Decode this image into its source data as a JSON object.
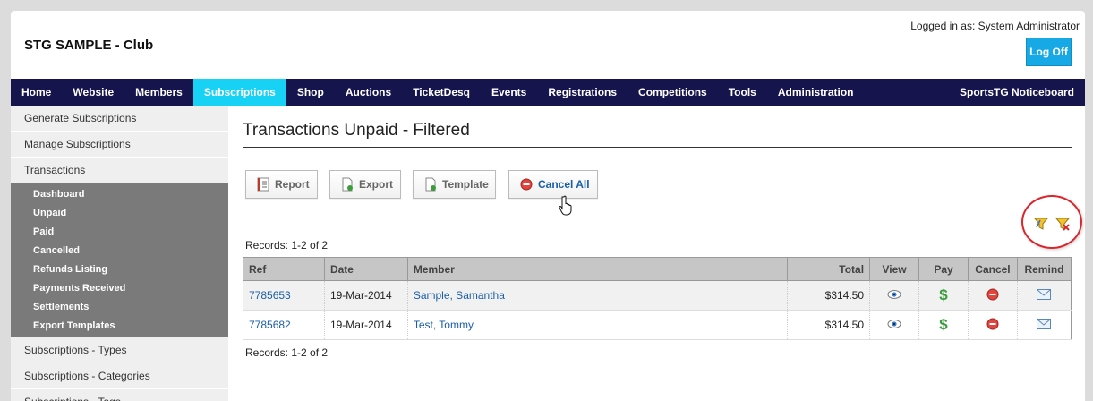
{
  "header": {
    "club_title": "STG SAMPLE - Club",
    "logged_in": "Logged in as: System Administrator",
    "logoff_label": "Log Off"
  },
  "nav": {
    "items": [
      "Home",
      "Website",
      "Members",
      "Subscriptions",
      "Shop",
      "Auctions",
      "TicketDesq",
      "Events",
      "Registrations",
      "Competitions",
      "Tools",
      "Administration"
    ],
    "active": "Subscriptions",
    "right_item": "SportsTG Noticeboard",
    "active_color": "#17d2f4",
    "bar_color": "#15144d"
  },
  "sidebar": {
    "items_top": [
      "Generate Subscriptions",
      "Manage Subscriptions",
      "Transactions"
    ],
    "sub_items": [
      "Dashboard",
      "Unpaid",
      "Paid",
      "Cancelled",
      "Refunds Listing",
      "Payments Received",
      "Settlements",
      "Export Templates"
    ],
    "items_bottom": [
      "Subscriptions - Types",
      "Subscriptions - Categories",
      "Subscriptions - Tags"
    ]
  },
  "main": {
    "title": "Transactions Unpaid - Filtered",
    "buttons": {
      "report": "Report",
      "export": "Export",
      "template": "Template",
      "cancel_all": "Cancel All"
    },
    "records_text": "Records: 1-2 of 2",
    "table": {
      "headers": {
        "ref": "Ref",
        "date": "Date",
        "member": "Member",
        "total": "Total",
        "view": "View",
        "pay": "Pay",
        "cancel": "Cancel",
        "remind": "Remind"
      },
      "rows": [
        {
          "ref": "7785653",
          "date": "19-Mar-2014",
          "member": "Sample, Samantha",
          "total": "$314.50"
        },
        {
          "ref": "7785682",
          "date": "19-Mar-2014",
          "member": "Test, Tommy",
          "total": "$314.50"
        }
      ]
    }
  }
}
